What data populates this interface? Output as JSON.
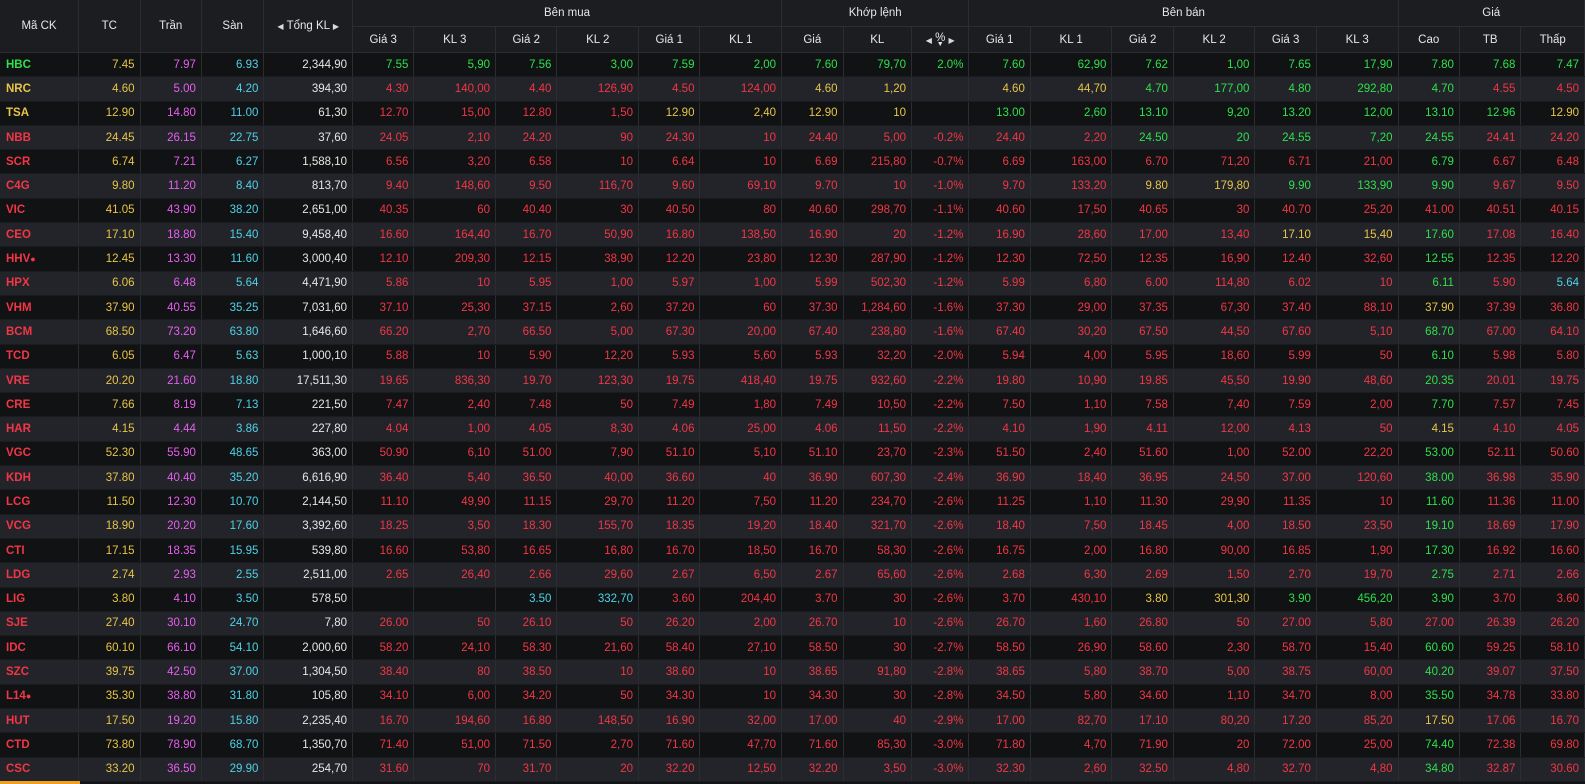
{
  "colors": {
    "up": "#2ee04b",
    "down": "#f23645",
    "ref": "#e8c547",
    "ceil": "#e85ef0",
    "floor": "#4fd2e8"
  },
  "header": {
    "symbol": "Mã CK",
    "ref": "TC",
    "ceil": "Trần",
    "floor": "Sàn",
    "total_vol": "Tổng KL",
    "buy_group": "Bên mua",
    "match_group": "Khớp lệnh",
    "sell_group": "Bên bán",
    "price_group": "Giá",
    "bid3": "Giá 3",
    "bidvol3": "KL 3",
    "bid2": "Giá 2",
    "bidvol2": "KL 2",
    "bid1": "Giá 1",
    "bidvol1": "KL 1",
    "match_price": "Giá",
    "match_vol": "KL",
    "match_pct": "%",
    "ask1": "Giá 1",
    "askvol1": "KL 1",
    "ask2": "Giá 2",
    "askvol2": "KL 2",
    "ask3": "Giá 3",
    "askvol3": "KL 3",
    "high": "Cao",
    "avg": "TB",
    "low": "Thấp"
  },
  "rows": [
    {
      "sym": "HBC",
      "dot": false,
      "tc": "7.45",
      "ce": "7.97",
      "fl": "6.93",
      "tkl": "2,344,90",
      "b3": "7.55",
      "bv3": "5,90",
      "b2": "7.56",
      "bv2": "3,00",
      "b1": "7.59",
      "bv1": "2,00",
      "mp": "7.60",
      "mv": "79,70",
      "pct": "2.0%",
      "a1": "7.60",
      "av1": "62,90",
      "a2": "7.62",
      "av2": "1,00",
      "a3": "7.65",
      "av3": "17,90",
      "hi": "7.80",
      "av": "7.68",
      "lo": "7.47"
    },
    {
      "sym": "NRC",
      "dot": false,
      "tc": "4.60",
      "ce": "5.00",
      "fl": "4.20",
      "tkl": "394,30",
      "b3": "4.30",
      "bv3": "140,00",
      "b2": "4.40",
      "bv2": "126,90",
      "b1": "4.50",
      "bv1": "124,00",
      "mp": "4.60",
      "mv": "1,20",
      "pct": "",
      "a1": "4.60",
      "av1": "44,70",
      "a2": "4.70",
      "av2": "177,00",
      "a3": "4.80",
      "av3": "292,80",
      "hi": "4.70",
      "av": "4.55",
      "lo": "4.50"
    },
    {
      "sym": "TSA",
      "dot": false,
      "tc": "12.90",
      "ce": "14.80",
      "fl": "11.00",
      "tkl": "61,30",
      "b3": "12.70",
      "bv3": "15,00",
      "b2": "12.80",
      "bv2": "1,50",
      "b1": "12.90",
      "bv1": "2,40",
      "mp": "12.90",
      "mv": "10",
      "pct": "",
      "a1": "13.00",
      "av1": "2,60",
      "a2": "13.10",
      "av2": "9,20",
      "a3": "13.20",
      "av3": "12,00",
      "hi": "13.10",
      "av": "12.96",
      "lo": "12.90"
    },
    {
      "sym": "NBB",
      "dot": false,
      "tc": "24.45",
      "ce": "26.15",
      "fl": "22.75",
      "tkl": "37,60",
      "b3": "24.05",
      "bv3": "2,10",
      "b2": "24.20",
      "bv2": "90",
      "b1": "24.30",
      "bv1": "10",
      "mp": "24.40",
      "mv": "5,00",
      "pct": "-0.2%",
      "a1": "24.40",
      "av1": "2,20",
      "a2": "24.50",
      "av2": "20",
      "a3": "24.55",
      "av3": "7,20",
      "hi": "24.55",
      "av": "24.41",
      "lo": "24.20"
    },
    {
      "sym": "SCR",
      "dot": false,
      "tc": "6.74",
      "ce": "7.21",
      "fl": "6.27",
      "tkl": "1,588,10",
      "b3": "6.56",
      "bv3": "3,20",
      "b2": "6.58",
      "bv2": "10",
      "b1": "6.64",
      "bv1": "10",
      "mp": "6.69",
      "mv": "215,80",
      "pct": "-0.7%",
      "a1": "6.69",
      "av1": "163,00",
      "a2": "6.70",
      "av2": "71,20",
      "a3": "6.71",
      "av3": "21,00",
      "hi": "6.79",
      "av": "6.67",
      "lo": "6.48"
    },
    {
      "sym": "C4G",
      "dot": false,
      "tc": "9.80",
      "ce": "11.20",
      "fl": "8.40",
      "tkl": "813,70",
      "b3": "9.40",
      "bv3": "148,60",
      "b2": "9.50",
      "bv2": "116,70",
      "b1": "9.60",
      "bv1": "69,10",
      "mp": "9.70",
      "mv": "10",
      "pct": "-1.0%",
      "a1": "9.70",
      "av1": "133,20",
      "a2": "9.80",
      "av2": "179,80",
      "a3": "9.90",
      "av3": "133,90",
      "hi": "9.90",
      "av": "9.67",
      "lo": "9.50"
    },
    {
      "sym": "VIC",
      "dot": false,
      "tc": "41.05",
      "ce": "43.90",
      "fl": "38.20",
      "tkl": "2,651,00",
      "b3": "40.35",
      "bv3": "60",
      "b2": "40.40",
      "bv2": "30",
      "b1": "40.50",
      "bv1": "80",
      "mp": "40.60",
      "mv": "298,70",
      "pct": "-1.1%",
      "a1": "40.60",
      "av1": "17,50",
      "a2": "40.65",
      "av2": "30",
      "a3": "40.70",
      "av3": "25,20",
      "hi": "41.00",
      "av": "40.51",
      "lo": "40.15"
    },
    {
      "sym": "CEO",
      "dot": false,
      "tc": "17.10",
      "ce": "18.80",
      "fl": "15.40",
      "tkl": "9,458,40",
      "b3": "16.60",
      "bv3": "164,40",
      "b2": "16.70",
      "bv2": "50,90",
      "b1": "16.80",
      "bv1": "138,50",
      "mp": "16.90",
      "mv": "20",
      "pct": "-1.2%",
      "a1": "16.90",
      "av1": "28,60",
      "a2": "17.00",
      "av2": "13,40",
      "a3": "17.10",
      "av3": "15,40",
      "hi": "17.60",
      "av": "17.08",
      "lo": "16.40"
    },
    {
      "sym": "HHV",
      "dot": true,
      "tc": "12.45",
      "ce": "13.30",
      "fl": "11.60",
      "tkl": "3,000,40",
      "b3": "12.10",
      "bv3": "209,30",
      "b2": "12.15",
      "bv2": "38,90",
      "b1": "12.20",
      "bv1": "23,80",
      "mp": "12.30",
      "mv": "287,90",
      "pct": "-1.2%",
      "a1": "12.30",
      "av1": "72,50",
      "a2": "12.35",
      "av2": "16,90",
      "a3": "12.40",
      "av3": "32,60",
      "hi": "12.55",
      "av": "12.35",
      "lo": "12.20"
    },
    {
      "sym": "HPX",
      "dot": false,
      "tc": "6.06",
      "ce": "6.48",
      "fl": "5.64",
      "tkl": "4,471,90",
      "b3": "5.86",
      "bv3": "10",
      "b2": "5.95",
      "bv2": "1,00",
      "b1": "5.97",
      "bv1": "1,00",
      "mp": "5.99",
      "mv": "502,30",
      "pct": "-1.2%",
      "a1": "5.99",
      "av1": "6,80",
      "a2": "6.00",
      "av2": "114,80",
      "a3": "6.02",
      "av3": "10",
      "hi": "6.11",
      "av": "5.90",
      "lo": "5.64"
    },
    {
      "sym": "VHM",
      "dot": false,
      "tc": "37.90",
      "ce": "40.55",
      "fl": "35.25",
      "tkl": "7,031,60",
      "b3": "37.10",
      "bv3": "25,30",
      "b2": "37.15",
      "bv2": "2,60",
      "b1": "37.20",
      "bv1": "60",
      "mp": "37.30",
      "mv": "1,284,60",
      "pct": "-1.6%",
      "a1": "37.30",
      "av1": "29,00",
      "a2": "37.35",
      "av2": "67,30",
      "a3": "37.40",
      "av3": "88,10",
      "hi": "37.90",
      "av": "37.39",
      "lo": "36.80"
    },
    {
      "sym": "BCM",
      "dot": false,
      "tc": "68.50",
      "ce": "73.20",
      "fl": "63.80",
      "tkl": "1,646,60",
      "b3": "66.20",
      "bv3": "2,70",
      "b2": "66.50",
      "bv2": "5,00",
      "b1": "67.30",
      "bv1": "20,00",
      "mp": "67.40",
      "mv": "238,80",
      "pct": "-1.6%",
      "a1": "67.40",
      "av1": "30,20",
      "a2": "67.50",
      "av2": "44,50",
      "a3": "67.60",
      "av3": "5,10",
      "hi": "68.70",
      "av": "67.00",
      "lo": "64.10"
    },
    {
      "sym": "TCD",
      "dot": false,
      "tc": "6.05",
      "ce": "6.47",
      "fl": "5.63",
      "tkl": "1,000,10",
      "b3": "5.88",
      "bv3": "10",
      "b2": "5.90",
      "bv2": "12,20",
      "b1": "5.93",
      "bv1": "5,60",
      "mp": "5.93",
      "mv": "32,20",
      "pct": "-2.0%",
      "a1": "5.94",
      "av1": "4,00",
      "a2": "5.95",
      "av2": "18,60",
      "a3": "5.99",
      "av3": "50",
      "hi": "6.10",
      "av": "5.98",
      "lo": "5.80"
    },
    {
      "sym": "VRE",
      "dot": false,
      "tc": "20.20",
      "ce": "21.60",
      "fl": "18.80",
      "tkl": "17,511,30",
      "b3": "19.65",
      "bv3": "836,30",
      "b2": "19.70",
      "bv2": "123,30",
      "b1": "19.75",
      "bv1": "418,40",
      "mp": "19.75",
      "mv": "932,60",
      "pct": "-2.2%",
      "a1": "19.80",
      "av1": "10,90",
      "a2": "19.85",
      "av2": "45,50",
      "a3": "19.90",
      "av3": "48,60",
      "hi": "20.35",
      "av": "20.01",
      "lo": "19.75"
    },
    {
      "sym": "CRE",
      "dot": false,
      "tc": "7.66",
      "ce": "8.19",
      "fl": "7.13",
      "tkl": "221,50",
      "b3": "7.47",
      "bv3": "2,40",
      "b2": "7.48",
      "bv2": "50",
      "b1": "7.49",
      "bv1": "1,80",
      "mp": "7.49",
      "mv": "10,50",
      "pct": "-2.2%",
      "a1": "7.50",
      "av1": "1,10",
      "a2": "7.58",
      "av2": "7,40",
      "a3": "7.59",
      "av3": "2,00",
      "hi": "7.70",
      "av": "7.57",
      "lo": "7.45"
    },
    {
      "sym": "HAR",
      "dot": false,
      "tc": "4.15",
      "ce": "4.44",
      "fl": "3.86",
      "tkl": "227,80",
      "b3": "4.04",
      "bv3": "1,00",
      "b2": "4.05",
      "bv2": "8,30",
      "b1": "4.06",
      "bv1": "25,00",
      "mp": "4.06",
      "mv": "11,50",
      "pct": "-2.2%",
      "a1": "4.10",
      "av1": "1,90",
      "a2": "4.11",
      "av2": "12,00",
      "a3": "4.13",
      "av3": "50",
      "hi": "4.15",
      "av": "4.10",
      "lo": "4.05"
    },
    {
      "sym": "VGC",
      "dot": false,
      "tc": "52.30",
      "ce": "55.90",
      "fl": "48.65",
      "tkl": "363,00",
      "b3": "50.90",
      "bv3": "6,10",
      "b2": "51.00",
      "bv2": "7,90",
      "b1": "51.10",
      "bv1": "5,10",
      "mp": "51.10",
      "mv": "23,70",
      "pct": "-2.3%",
      "a1": "51.50",
      "av1": "2,40",
      "a2": "51.60",
      "av2": "1,00",
      "a3": "52.00",
      "av3": "22,20",
      "hi": "53.00",
      "av": "52.11",
      "lo": "50.60"
    },
    {
      "sym": "KDH",
      "dot": false,
      "tc": "37.80",
      "ce": "40.40",
      "fl": "35.20",
      "tkl": "6,616,90",
      "b3": "36.40",
      "bv3": "5,40",
      "b2": "36.50",
      "bv2": "40,00",
      "b1": "36.60",
      "bv1": "40",
      "mp": "36.90",
      "mv": "607,30",
      "pct": "-2.4%",
      "a1": "36.90",
      "av1": "18,40",
      "a2": "36.95",
      "av2": "24,50",
      "a3": "37.00",
      "av3": "120,60",
      "hi": "38.00",
      "av": "36.98",
      "lo": "35.90"
    },
    {
      "sym": "LCG",
      "dot": false,
      "tc": "11.50",
      "ce": "12.30",
      "fl": "10.70",
      "tkl": "2,144,50",
      "b3": "11.10",
      "bv3": "49,90",
      "b2": "11.15",
      "bv2": "29,70",
      "b1": "11.20",
      "bv1": "7,50",
      "mp": "11.20",
      "mv": "234,70",
      "pct": "-2.6%",
      "a1": "11.25",
      "av1": "1,10",
      "a2": "11.30",
      "av2": "29,90",
      "a3": "11.35",
      "av3": "10",
      "hi": "11.60",
      "av": "11.36",
      "lo": "11.00"
    },
    {
      "sym": "VCG",
      "dot": false,
      "tc": "18.90",
      "ce": "20.20",
      "fl": "17.60",
      "tkl": "3,392,60",
      "b3": "18.25",
      "bv3": "3,50",
      "b2": "18.30",
      "bv2": "155,70",
      "b1": "18.35",
      "bv1": "19,20",
      "mp": "18.40",
      "mv": "321,70",
      "pct": "-2.6%",
      "a1": "18.40",
      "av1": "7,50",
      "a2": "18.45",
      "av2": "4,00",
      "a3": "18.50",
      "av3": "23,50",
      "hi": "19.10",
      "av": "18.69",
      "lo": "17.90"
    },
    {
      "sym": "CTI",
      "dot": false,
      "tc": "17.15",
      "ce": "18.35",
      "fl": "15.95",
      "tkl": "539,80",
      "b3": "16.60",
      "bv3": "53,80",
      "b2": "16.65",
      "bv2": "16,80",
      "b1": "16.70",
      "bv1": "18,50",
      "mp": "16.70",
      "mv": "58,30",
      "pct": "-2.6%",
      "a1": "16.75",
      "av1": "2,00",
      "a2": "16.80",
      "av2": "90,00",
      "a3": "16.85",
      "av3": "1,90",
      "hi": "17.30",
      "av": "16.92",
      "lo": "16.60"
    },
    {
      "sym": "LDG",
      "dot": false,
      "tc": "2.74",
      "ce": "2.93",
      "fl": "2.55",
      "tkl": "2,511,00",
      "b3": "2.65",
      "bv3": "26,40",
      "b2": "2.66",
      "bv2": "29,60",
      "b1": "2.67",
      "bv1": "6,50",
      "mp": "2.67",
      "mv": "65,60",
      "pct": "-2.6%",
      "a1": "2.68",
      "av1": "6,30",
      "a2": "2.69",
      "av2": "1,50",
      "a3": "2.70",
      "av3": "19,70",
      "hi": "2.75",
      "av": "2.71",
      "lo": "2.66"
    },
    {
      "sym": "LIG",
      "dot": false,
      "tc": "3.80",
      "ce": "4.10",
      "fl": "3.50",
      "tkl": "578,50",
      "b3": "",
      "bv3": "",
      "b2": "3.50",
      "bv2": "332,70",
      "b1": "3.60",
      "bv1": "204,40",
      "mp": "3.70",
      "mv": "30",
      "pct": "-2.6%",
      "a1": "3.70",
      "av1": "430,10",
      "a2": "3.80",
      "av2": "301,30",
      "a3": "3.90",
      "av3": "456,20",
      "hi": "3.90",
      "av": "3.70",
      "lo": "3.60"
    },
    {
      "sym": "SJE",
      "dot": false,
      "tc": "27.40",
      "ce": "30.10",
      "fl": "24.70",
      "tkl": "7,80",
      "b3": "26.00",
      "bv3": "50",
      "b2": "26.10",
      "bv2": "50",
      "b1": "26.20",
      "bv1": "2,00",
      "mp": "26.70",
      "mv": "10",
      "pct": "-2.6%",
      "a1": "26.70",
      "av1": "1,60",
      "a2": "26.80",
      "av2": "50",
      "a3": "27.00",
      "av3": "5,80",
      "hi": "27.00",
      "av": "26.39",
      "lo": "26.20"
    },
    {
      "sym": "IDC",
      "dot": false,
      "tc": "60.10",
      "ce": "66.10",
      "fl": "54.10",
      "tkl": "2,000,60",
      "b3": "58.20",
      "bv3": "24,10",
      "b2": "58.30",
      "bv2": "21,60",
      "b1": "58.40",
      "bv1": "27,10",
      "mp": "58.50",
      "mv": "30",
      "pct": "-2.7%",
      "a1": "58.50",
      "av1": "26,90",
      "a2": "58.60",
      "av2": "2,30",
      "a3": "58.70",
      "av3": "15,40",
      "hi": "60.60",
      "av": "59.25",
      "lo": "58.10"
    },
    {
      "sym": "SZC",
      "dot": false,
      "tc": "39.75",
      "ce": "42.50",
      "fl": "37.00",
      "tkl": "1,304,50",
      "b3": "38.40",
      "bv3": "80",
      "b2": "38.50",
      "bv2": "10",
      "b1": "38.60",
      "bv1": "10",
      "mp": "38.65",
      "mv": "91,80",
      "pct": "-2.8%",
      "a1": "38.65",
      "av1": "5,80",
      "a2": "38.70",
      "av2": "5,00",
      "a3": "38.75",
      "av3": "60,00",
      "hi": "40.20",
      "av": "39.07",
      "lo": "37.50"
    },
    {
      "sym": "L14",
      "dot": true,
      "tc": "35.30",
      "ce": "38.80",
      "fl": "31.80",
      "tkl": "105,80",
      "b3": "34.10",
      "bv3": "6,00",
      "b2": "34.20",
      "bv2": "50",
      "b1": "34.30",
      "bv1": "10",
      "mp": "34.30",
      "mv": "30",
      "pct": "-2.8%",
      "a1": "34.50",
      "av1": "5,80",
      "a2": "34.60",
      "av2": "1,10",
      "a3": "34.70",
      "av3": "8,00",
      "hi": "35.50",
      "av": "34.78",
      "lo": "33.80"
    },
    {
      "sym": "HUT",
      "dot": false,
      "tc": "17.50",
      "ce": "19.20",
      "fl": "15.80",
      "tkl": "2,235,40",
      "b3": "16.70",
      "bv3": "194,60",
      "b2": "16.80",
      "bv2": "148,50",
      "b1": "16.90",
      "bv1": "32,00",
      "mp": "17.00",
      "mv": "40",
      "pct": "-2.9%",
      "a1": "17.00",
      "av1": "82,70",
      "a2": "17.10",
      "av2": "80,20",
      "a3": "17.20",
      "av3": "85,20",
      "hi": "17.50",
      "av": "17.06",
      "lo": "16.70"
    },
    {
      "sym": "CTD",
      "dot": false,
      "tc": "73.80",
      "ce": "78.90",
      "fl": "68.70",
      "tkl": "1,350,70",
      "b3": "71.40",
      "bv3": "51,00",
      "b2": "71.50",
      "bv2": "2,70",
      "b1": "71.60",
      "bv1": "47,70",
      "mp": "71.60",
      "mv": "85,30",
      "pct": "-3.0%",
      "a1": "71.80",
      "av1": "4,70",
      "a2": "71.90",
      "av2": "20",
      "a3": "72.00",
      "av3": "25,00",
      "hi": "74.40",
      "av": "72.38",
      "lo": "69.80"
    },
    {
      "sym": "CSC",
      "dot": false,
      "tc": "33.20",
      "ce": "36.50",
      "fl": "29.90",
      "tkl": "254,70",
      "b3": "31.60",
      "bv3": "70",
      "b2": "31.70",
      "bv2": "20",
      "b1": "32.20",
      "bv1": "12,50",
      "mp": "32.20",
      "mv": "3,50",
      "pct": "-3.0%",
      "a1": "32.30",
      "av1": "2,60",
      "a2": "32.50",
      "av2": "4,80",
      "a3": "32.70",
      "av3": "4,80",
      "hi": "34.80",
      "av": "32.87",
      "lo": "30.60"
    }
  ]
}
